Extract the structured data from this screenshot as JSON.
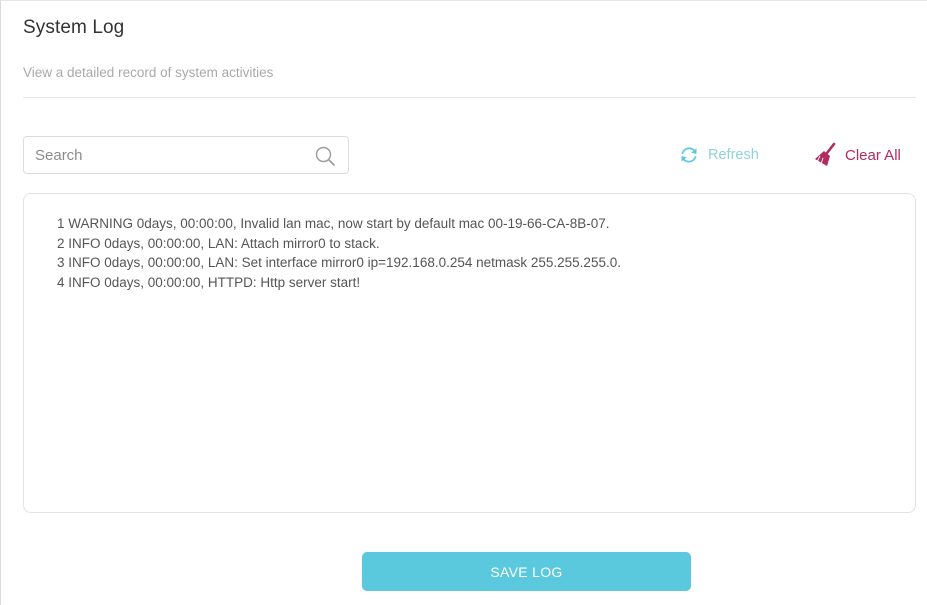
{
  "header": {
    "title": "System Log",
    "subtitle": "View a detailed record of system activities"
  },
  "toolbar": {
    "search": {
      "placeholder": "Search",
      "value": "",
      "icon": "search-icon"
    },
    "refresh": {
      "label": "Refresh",
      "icon": "refresh-icon",
      "color": "#8fd1dc"
    },
    "clear_all": {
      "label": "Clear All",
      "icon": "broom-icon",
      "color": "#b22b5f"
    }
  },
  "log": {
    "lines": [
      "1 WARNING 0days, 00:00:00, Invalid lan mac, now start by default mac 00-19-66-CA-8B-07.",
      "2 INFO 0days, 00:00:00, LAN: Attach mirror0 to stack.",
      "3 INFO 0days, 00:00:00, LAN: Set interface mirror0 ip=192.168.0.254 netmask 255.255.255.0.",
      "4 INFO 0days, 00:00:00, HTTPD: Http server start!"
    ]
  },
  "actions": {
    "save_label": "SAVE LOG",
    "accent_color": "#5bc9dd"
  }
}
